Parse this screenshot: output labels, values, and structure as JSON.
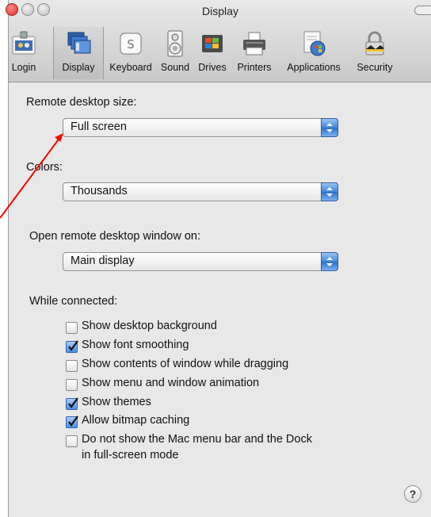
{
  "window": {
    "title": "Display"
  },
  "toolbar": {
    "items": [
      {
        "label": "Login",
        "icon": "login-icon"
      },
      {
        "label": "Display",
        "icon": "display-icon",
        "selected": true
      },
      {
        "label": "Keyboard",
        "icon": "keyboard-icon"
      },
      {
        "label": "Sound",
        "icon": "sound-icon"
      },
      {
        "label": "Drives",
        "icon": "drives-icon"
      },
      {
        "label": "Printers",
        "icon": "printers-icon"
      },
      {
        "label": "Applications",
        "icon": "applications-icon"
      },
      {
        "label": "Security",
        "icon": "security-icon"
      }
    ]
  },
  "remote_size": {
    "label": "Remote desktop size:",
    "value": "Full screen"
  },
  "colors": {
    "label": "Colors:",
    "value": "Thousands"
  },
  "open_on": {
    "label": "Open remote desktop window on:",
    "value": "Main display"
  },
  "while_connected": {
    "label": "While connected:",
    "options": [
      {
        "label": "Show desktop background",
        "checked": false
      },
      {
        "label": "Show font smoothing",
        "checked": true
      },
      {
        "label": "Show contents of window while dragging",
        "checked": false
      },
      {
        "label": "Show menu and window animation",
        "checked": false
      },
      {
        "label": "Show themes",
        "checked": true
      },
      {
        "label": "Allow bitmap caching",
        "checked": true
      },
      {
        "label": "Do not show the Mac menu bar and the Dock",
        "label2": "in full-screen mode",
        "checked": false
      }
    ]
  },
  "help": {
    "symbol": "?"
  },
  "colors_theme": {
    "accent": "#3d85dd",
    "annotation": "#ff0000"
  }
}
